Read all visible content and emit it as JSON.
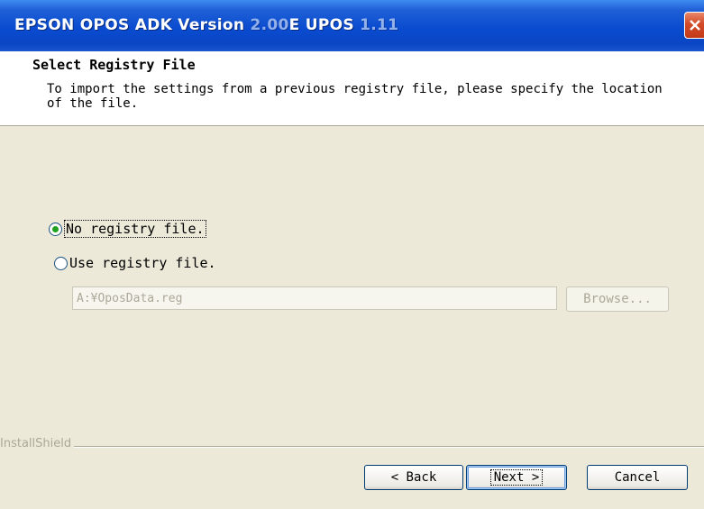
{
  "window": {
    "title_prefix": "EPSON OPOS ADK Version",
    "title_version_faint": "2.00",
    "title_mid": "E UPOS",
    "title_suffix_faint": "1.11"
  },
  "header": {
    "title": "Select Registry File",
    "description": "To import the settings from a previous registry file, please specify the location of the file."
  },
  "options": [
    {
      "label": "No registry file.",
      "selected": true
    },
    {
      "label": "Use registry file.",
      "selected": false
    }
  ],
  "path_field": {
    "value": "A:¥OposData.reg"
  },
  "browse_button": {
    "label": "Browse..."
  },
  "footer": {
    "brand": "InstallShield",
    "back_label": "< Back",
    "next_label": "Next >",
    "cancel_label": "Cancel"
  },
  "colors": {
    "title_bar": "#0a46c4",
    "close_button": "#d24a28",
    "dialog_bg": "#ece9d8",
    "radio_dot": "#21a121"
  },
  "icons": {
    "close": "close-icon"
  }
}
